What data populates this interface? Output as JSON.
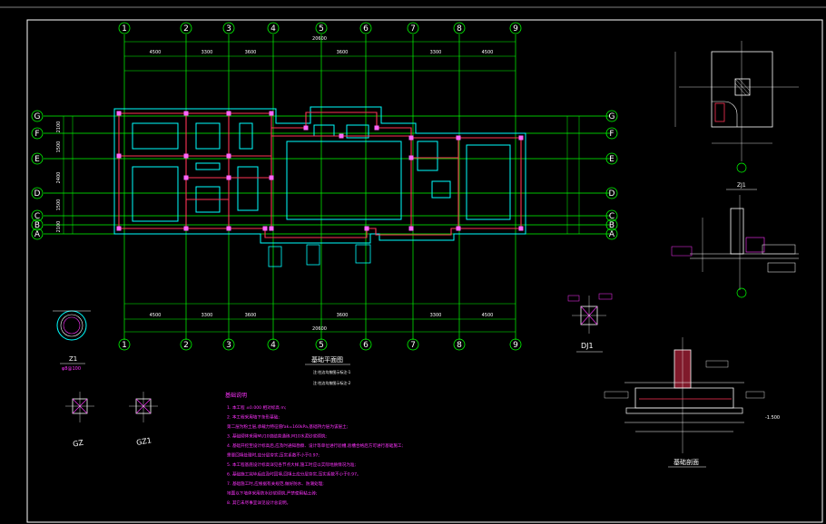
{
  "drawing": {
    "background": "#000000",
    "colors": {
      "axis": "#00ff00",
      "outline": "#00ffff",
      "wall": "#ff3355",
      "frame": "#ffffff",
      "text_mag": "#ff33ff",
      "column": "#ff66ff"
    },
    "plan": {
      "title": "基础平面图",
      "subtitle1": "注:柱边均按图示标注-1",
      "subtitle2": "注:柱边均按图示标注-2",
      "col_axes": [
        "1",
        "2",
        "3",
        "4",
        "5",
        "6",
        "7",
        "8",
        "9"
      ],
      "row_axes": [
        "G",
        "F",
        "E",
        "D",
        "C",
        "B",
        "A"
      ],
      "top_dims": [
        "4500",
        "3300",
        "3600",
        "3600",
        "3300",
        "4500"
      ],
      "top_total": "20600",
      "bottom_dims": [
        "4500",
        "3300",
        "3600",
        "3600",
        "3300",
        "4500"
      ],
      "bottom_total": "20600",
      "side_dims": [
        "2100",
        "1500",
        "2400",
        "1500",
        "2100"
      ]
    },
    "details": {
      "z1_label": "Z1",
      "z1_note": "φ8@100",
      "gz_label": "GZ",
      "gz1_label": "GZ1",
      "zj_label": "ZJ1",
      "dj1_label": "DJ1",
      "section_label": "基础剖面",
      "elev_label": "-1.500"
    },
    "notes": {
      "title": "基础说明",
      "lines": [
        "1. 本工程 ±0.000 相对标高 m;",
        "2. 本工程采用墙下条形基础;",
        "第二层为粉土层,承载力特征值fak=160kPa,基础持力层为该层土;",
        "3. 基础砌体采用MU10烧结普通砖,M10水泥砂浆砌筑;",
        "4. 基础开挖至设计标高后,应及时通知勘察、设计等单位进行验槽,验槽合格后方可进行基础施工;",
        "需要回填处理时,应分层夯实,压实系数不小于0.97;",
        "5. 本工程基底设计标高详见各节点大样,施工时应以实际地质情况为准;",
        "6. 基础施工完毕后应及时回填,回填土应分层夯实,压实系数不小于0.97。",
        "7. 基础施工时,应根据有关规范,做好防水、防潮处理;",
        "   地面以下墙体采用防水砂浆砌筑,严禁使用粘土砖;",
        "8. 其它未尽事宜详见设计总说明。"
      ]
    }
  }
}
